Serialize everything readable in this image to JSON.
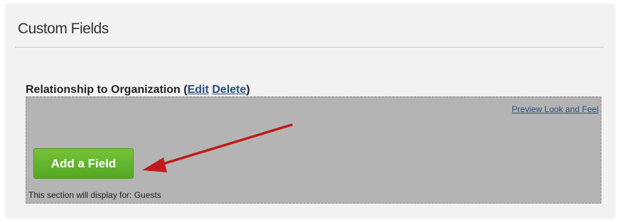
{
  "page": {
    "title": "Custom Fields"
  },
  "section": {
    "name": "Relationship to Organization",
    "paren_open": " (",
    "edit_label": "Edit",
    "delete_label": "Delete",
    "paren_close": ")",
    "preview_label": "Preview Look and Feel",
    "add_field_label": "Add a Field",
    "display_note": "This section will display for: Guests"
  },
  "colors": {
    "add_button": "#5cb32b",
    "annotation_arrow": "#c01a1a",
    "link": "#2a4e7a",
    "section_bg": "#b4b4b4"
  },
  "icons": {
    "annotation": "red-arrow-annotation"
  }
}
